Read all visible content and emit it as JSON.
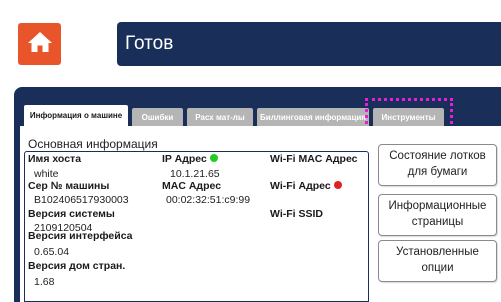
{
  "header": {
    "status_title": "Готов",
    "home_icon": "home-icon"
  },
  "tabs": [
    {
      "label": "Информация о машине",
      "active": true
    },
    {
      "label": "Ошибки"
    },
    {
      "label": "Расх мат-лы"
    },
    {
      "label": "Биллинговая информация"
    },
    {
      "label": "Инструменты"
    }
  ],
  "section": {
    "title": "Основная информация"
  },
  "info": {
    "hostname_label": "Имя хоста",
    "hostname_value": "white",
    "ip_label": "IP Адрес",
    "ip_value": "10.1.21.65",
    "ip_status_color": "#22cc22",
    "wifi_mac_label": "Wi-Fi MAC Адрес",
    "serial_label": "Сер № машины",
    "serial_value": "B102406517930003",
    "mac_label": "MAC Адрес",
    "mac_value": "00:02:32:51:c9:99",
    "wifi_ip_label": "Wi-Fi Адрес",
    "wifi_status_color": "#dd2222",
    "system_version_label": "Версия системы",
    "system_version_value": "2109120504",
    "wifi_ssid_label": "Wi-Fi SSID",
    "interface_version_label": "Версия интерфейса",
    "interface_version_value": "0.65.04",
    "homepage_version_label": "Версия дом стран.",
    "homepage_version_value": "1.68"
  },
  "side_buttons": [
    {
      "label": "Состояние лотков для бумаги"
    },
    {
      "label": "Информационные страницы"
    },
    {
      "label": "Установленные опции"
    }
  ],
  "colors": {
    "header_bg": "#1a2e5a",
    "home_button": "#e8552a",
    "tab_inactive": "#b5b5b5",
    "selection_highlight": "#e51fd6"
  }
}
